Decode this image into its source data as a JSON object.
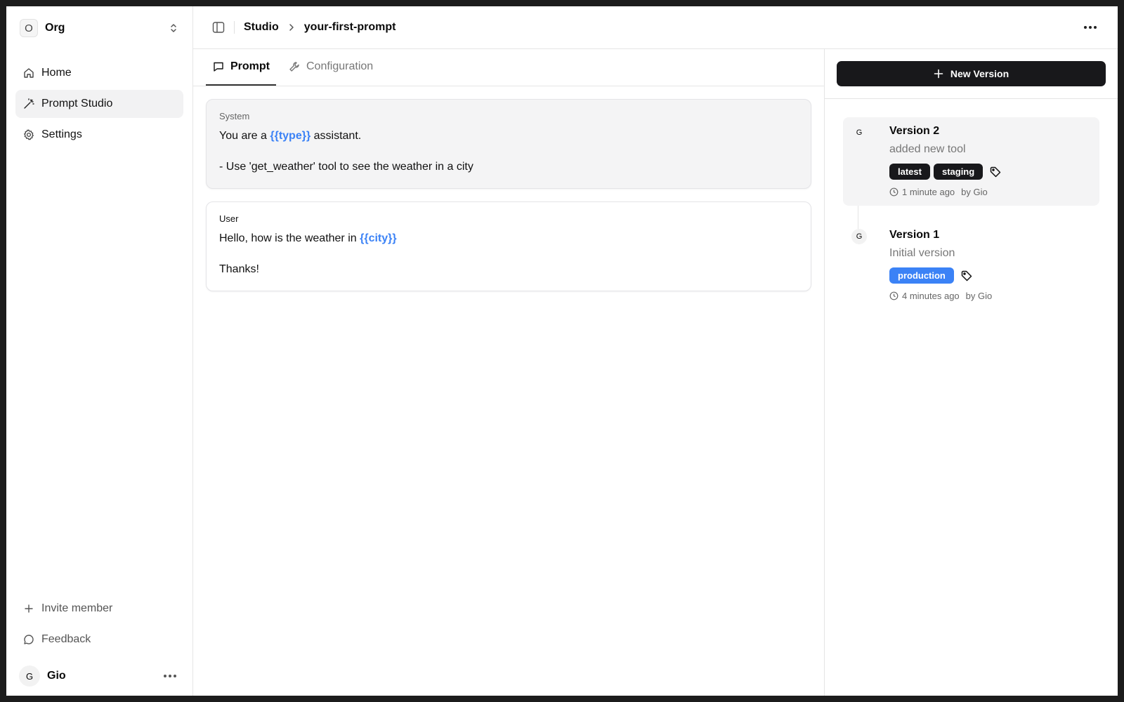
{
  "org": {
    "initial": "O",
    "name": "Org"
  },
  "nav": {
    "home": "Home",
    "studio": "Prompt Studio",
    "settings": "Settings"
  },
  "bottom": {
    "invite": "Invite member",
    "feedback": "Feedback"
  },
  "user": {
    "initial": "G",
    "name": "Gio"
  },
  "breadcrumb": {
    "root": "Studio",
    "current": "your-first-prompt"
  },
  "tabs": {
    "prompt": "Prompt",
    "configuration": "Configuration"
  },
  "messages": {
    "system": {
      "role": "System",
      "line1_pre": "You are a ",
      "line1_var": "{{type}}",
      "line1_post": " assistant.",
      "line2": "- Use 'get_weather' tool to see the weather in a city"
    },
    "user": {
      "role": "User",
      "line1_pre": "Hello, how is the weather in ",
      "line1_var": "{{city}}",
      "line2": "Thanks!"
    }
  },
  "versions_panel": {
    "new_label": "New Version",
    "items": [
      {
        "avatar": "G",
        "name": "Version 2",
        "desc": "added new tool",
        "tags": [
          "latest",
          "staging"
        ],
        "time": "1 minute ago",
        "by": "by Gio"
      },
      {
        "avatar": "G",
        "name": "Version 1",
        "desc": "Initial version",
        "tags": [
          "production"
        ],
        "time": "4 minutes ago",
        "by": "by Gio"
      }
    ]
  },
  "colors": {
    "accent": "#3b82f6",
    "dark": "#18181b"
  }
}
